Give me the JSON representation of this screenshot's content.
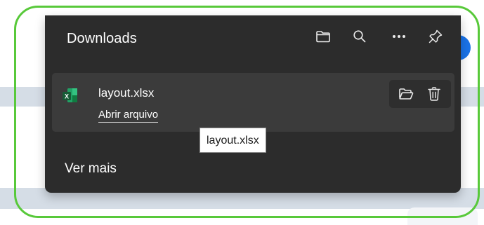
{
  "panel": {
    "title": "Downloads",
    "header_icons": [
      "folder-icon",
      "search-icon",
      "more-icon",
      "pin-icon"
    ],
    "see_more_label": "Ver mais"
  },
  "downloads": [
    {
      "file_name": "layout.xlsx",
      "action_label": "Abrir arquivo",
      "file_icon": "excel-file-icon",
      "item_icons": [
        "open-folder-icon",
        "delete-icon"
      ]
    }
  ],
  "tooltip": {
    "text": "layout.xlsx"
  },
  "colors": {
    "panel_bg": "#2c2c2c",
    "item_bg": "#3b3b3b",
    "highlight_border": "#58c93a",
    "accent_blue": "#1a73e8",
    "excel_green": "#1f8b4c"
  }
}
